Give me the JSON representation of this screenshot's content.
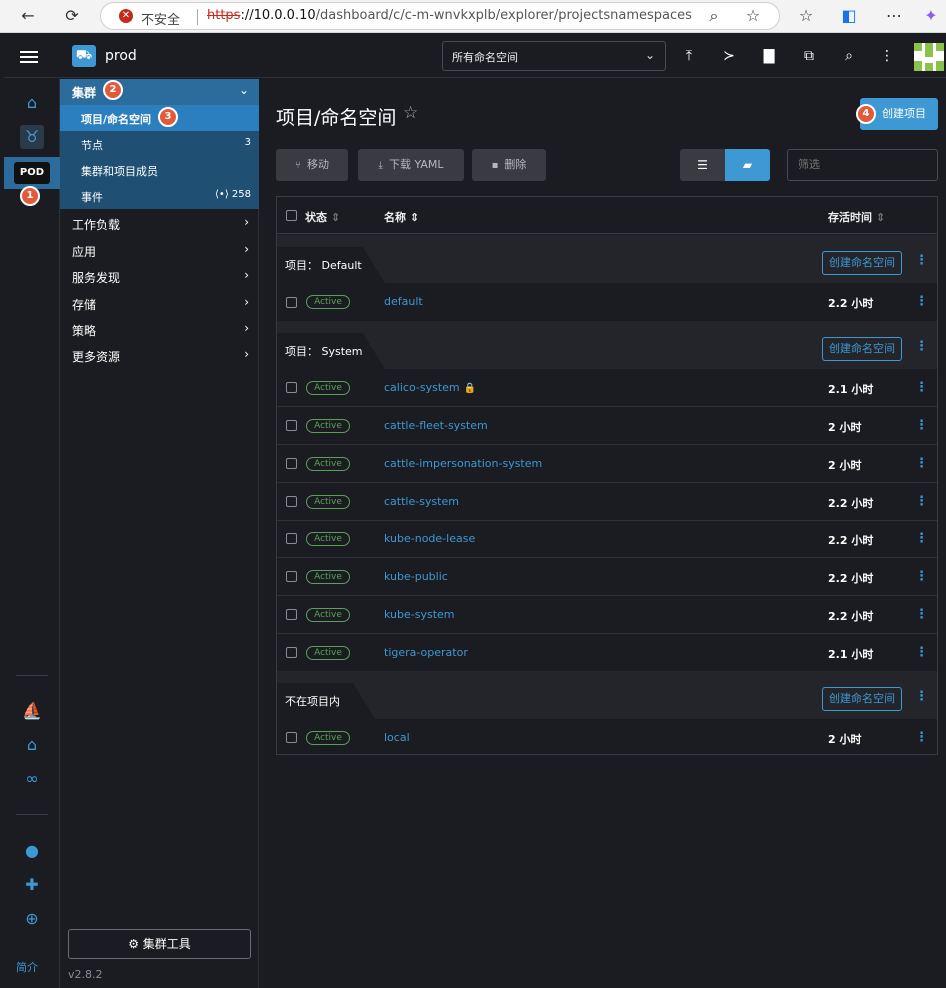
{
  "browser": {
    "insecure_label": "不安全",
    "url_scheme": "https",
    "url_host": "://10.0.0.10",
    "url_path": "/dashboard/c/c-m-wnvkxplb/explorer/projectsnamespaces"
  },
  "header": {
    "cluster_name": "prod",
    "namespace_filter": "所有命名空间"
  },
  "rail": {
    "pod_label": "POD",
    "about_label": "简介"
  },
  "sidebar": {
    "cluster_group": "集群",
    "sub_items": [
      {
        "label": "项目/命名空间",
        "count": ""
      },
      {
        "label": "节点",
        "count": "3"
      },
      {
        "label": "集群和项目成员",
        "count": ""
      },
      {
        "label": "事件",
        "count": "258"
      }
    ],
    "groups": [
      "工作负载",
      "应用",
      "服务发现",
      "存储",
      "策略",
      "更多资源"
    ],
    "cluster_tools": "集群工具",
    "version": "v2.8.2"
  },
  "annotations": [
    "1",
    "2",
    "3",
    "4"
  ],
  "page": {
    "title": "项目/命名空间",
    "create_project": "创建项目",
    "move": "移动",
    "download_yaml": "下载 YAML",
    "delete": "删除",
    "filter_placeholder": "筛选"
  },
  "table": {
    "headers": {
      "state": "状态",
      "name": "名称",
      "age": "存活时间"
    },
    "create_namespace": "创建命名空间",
    "groups": [
      {
        "label": "项目： Default",
        "rows": [
          {
            "state": "Active",
            "name": "default",
            "age": "2.2 小时",
            "locked": false
          }
        ]
      },
      {
        "label": "项目： System",
        "rows": [
          {
            "state": "Active",
            "name": "calico-system",
            "age": "2.1 小时",
            "locked": true
          },
          {
            "state": "Active",
            "name": "cattle-fleet-system",
            "age": "2 小时",
            "locked": false
          },
          {
            "state": "Active",
            "name": "cattle-impersonation-system",
            "age": "2 小时",
            "locked": false
          },
          {
            "state": "Active",
            "name": "cattle-system",
            "age": "2.2 小时",
            "locked": false
          },
          {
            "state": "Active",
            "name": "kube-node-lease",
            "age": "2.2 小时",
            "locked": false
          },
          {
            "state": "Active",
            "name": "kube-public",
            "age": "2.2 小时",
            "locked": false
          },
          {
            "state": "Active",
            "name": "kube-system",
            "age": "2.2 小时",
            "locked": false
          },
          {
            "state": "Active",
            "name": "tigera-operator",
            "age": "2.1 小时",
            "locked": false
          }
        ]
      },
      {
        "label": "不在项目内",
        "rows": [
          {
            "state": "Active",
            "name": "local",
            "age": "2 小时",
            "locked": false
          }
        ]
      }
    ]
  }
}
